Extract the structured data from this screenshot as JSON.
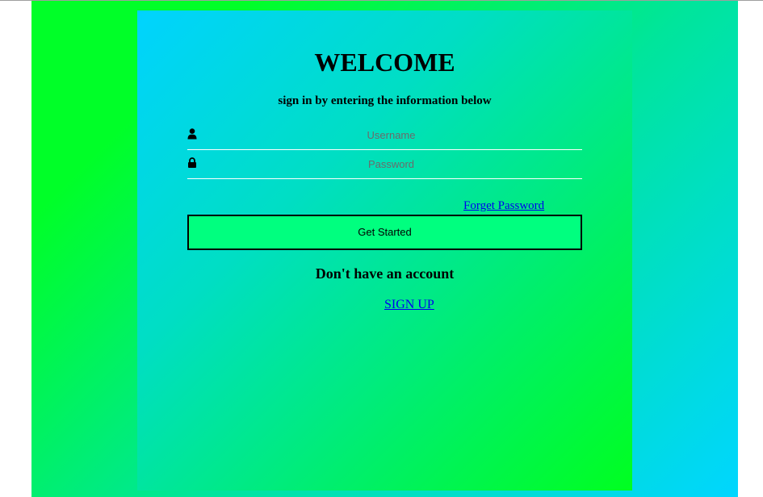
{
  "login": {
    "title": "WELCOME",
    "subtitle": "sign in by entering the information below",
    "username": {
      "placeholder": "Username",
      "value": "",
      "icon": "user-icon"
    },
    "password": {
      "placeholder": "Password",
      "value": "",
      "icon": "lock-icon"
    },
    "forget_label": "Forget Password",
    "submit_label": "Get Started",
    "no_account_text": "Don't have an account",
    "signup_label": "SIGN UP"
  },
  "colors": {
    "outer_gradient": [
      "#00ff28",
      "#00e59b",
      "#00d6ff"
    ],
    "panel_gradient": [
      "#00d3ff",
      "#00dec4",
      "#00ef6a",
      "#00ff20"
    ],
    "button_bg": "#00ff7f",
    "link": "#0000ee",
    "underline": "#ffffff"
  }
}
